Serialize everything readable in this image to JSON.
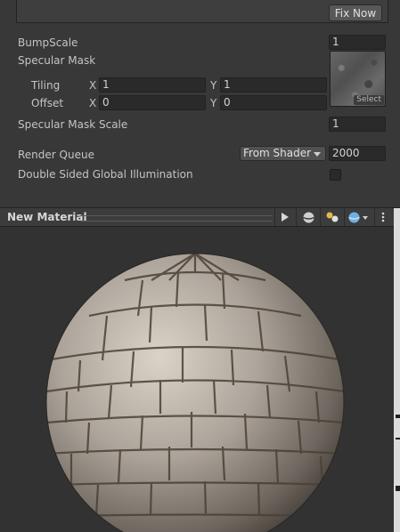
{
  "warning": {
    "fix_label": "Fix Now"
  },
  "properties": {
    "bump_scale": {
      "label": "BumpScale",
      "value": "1"
    },
    "specular_mask": {
      "label": "Specular Mask",
      "tiling": {
        "label": "Tiling",
        "x_label": "X",
        "x": "1",
        "y_label": "Y",
        "y": "1"
      },
      "offset": {
        "label": "Offset",
        "x_label": "X",
        "x": "0",
        "y_label": "Y",
        "y": "0"
      },
      "select_label": "Select"
    },
    "specular_mask_scale": {
      "label": "Specular Mask Scale",
      "value": "1"
    },
    "render_queue": {
      "label": "Render Queue",
      "mode": "From Shader",
      "value": "2000"
    },
    "double_sided_gi": {
      "label": "Double Sided Global Illumination",
      "checked": false
    }
  },
  "preview": {
    "title": "New Material",
    "icons": [
      "play-icon",
      "sphere-mesh-icon",
      "lighting-icon",
      "background-sphere-icon",
      "more-options-icon"
    ]
  },
  "colors": {
    "panel_bg": "#383838",
    "field_bg": "#2a2a2a",
    "preview_bg": "#323232",
    "text": "#c4c4c4"
  }
}
